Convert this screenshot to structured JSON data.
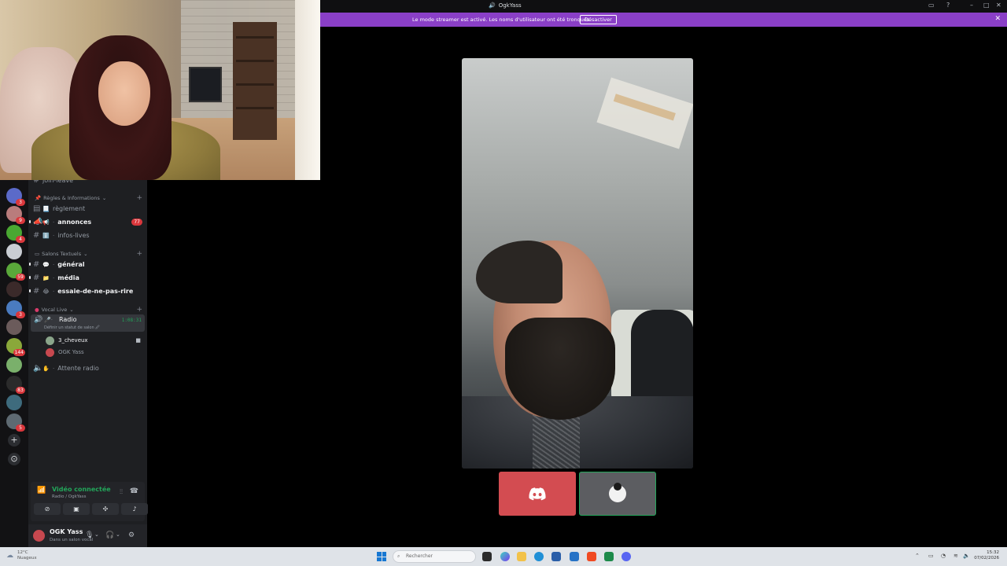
{
  "window": {
    "title": "OgkYass"
  },
  "banner": {
    "text": "Le mode streamer est activé. Les noms d'utilisateur ont été tronqués.",
    "button": "Désactiver",
    "close": "✕"
  },
  "sidebar": {
    "top_partial_channel": "join-leave",
    "categories": [
      {
        "label": "Règles & Informations"
      },
      {
        "label": "Salons Textuels"
      },
      {
        "label": "Vocal Live"
      }
    ],
    "channels": [
      {
        "name": "règlement",
        "emoji": "📃"
      },
      {
        "name": "annonces",
        "emoji": "📢",
        "badge": "77"
      },
      {
        "name": "infos-lives",
        "emoji": "ℹ️"
      },
      {
        "name": "général",
        "emoji": "💬"
      },
      {
        "name": "média",
        "emoji": "📁"
      },
      {
        "name": "essaie-de-ne-pas-rire",
        "emoji": "😂"
      }
    ],
    "voice": {
      "active_channel": "Radio",
      "timer": "1:08:31",
      "status_hint": "Définir un statut de salon 🖉",
      "users": [
        "3_cheveux",
        "OGK Yass"
      ],
      "second_channel": "Attente radio"
    },
    "connection": {
      "title": "Vidéo connectée",
      "subtitle": "Radio / OgkYass"
    },
    "user": {
      "name": "OGK Yass",
      "status": "Dans un salon vocal"
    }
  },
  "server_badges": [
    "3",
    "9",
    "4",
    "",
    "59",
    "",
    "3",
    "",
    "5",
    "144",
    "",
    "83",
    "",
    "5"
  ],
  "taskbar": {
    "weather_temp": "12°C",
    "weather_desc": "Nuageux",
    "search_placeholder": "Rechercher",
    "time": "15:32",
    "date": "07/02/2026"
  },
  "colors": {
    "banner": "#8a3fc7",
    "connected": "#23a55a",
    "badge": "#da373c"
  }
}
